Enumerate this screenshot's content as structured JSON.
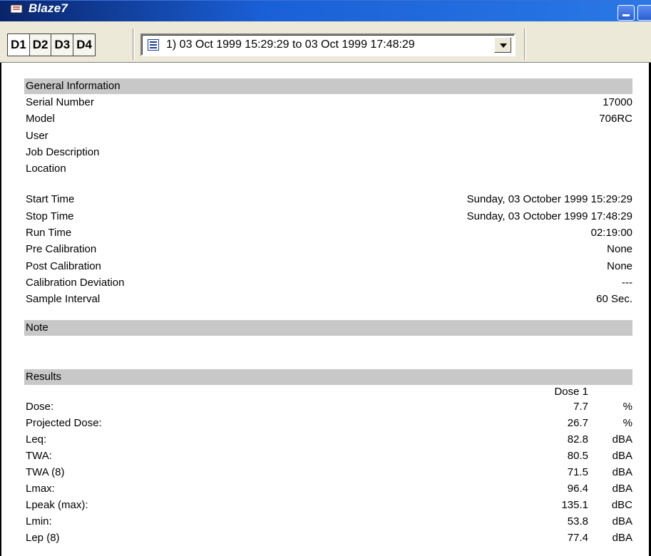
{
  "window": {
    "title": "Blaze7"
  },
  "toolbar": {
    "dataset_buttons": [
      "D1",
      "D2",
      "D3",
      "D4"
    ],
    "session_select": "1) 03 Oct 1999 15:29:29 to 03 Oct 1999 17:48:29"
  },
  "general": {
    "header": "General Information",
    "rows": [
      {
        "label": "Serial Number",
        "value": "17000"
      },
      {
        "label": "Model",
        "value": "706RC"
      },
      {
        "label": "User",
        "value": ""
      },
      {
        "label": "Job Description",
        "value": ""
      },
      {
        "label": "Location",
        "value": ""
      }
    ]
  },
  "timing": {
    "rows": [
      {
        "label": "Start Time",
        "value": "Sunday, 03 October 1999 15:29:29"
      },
      {
        "label": "Stop Time",
        "value": "Sunday, 03 October 1999 17:48:29"
      },
      {
        "label": "Run Time",
        "value": "02:19:00"
      },
      {
        "label": "Pre Calibration",
        "value": "None"
      },
      {
        "label": "Post Calibration",
        "value": "None"
      },
      {
        "label": "Calibration Deviation",
        "value": "---"
      },
      {
        "label": "Sample Interval",
        "value": "60 Sec."
      }
    ]
  },
  "note": {
    "header": "Note"
  },
  "results": {
    "header": "Results",
    "column": "Dose 1",
    "rows": [
      {
        "label": "Dose:",
        "value": "7.7",
        "unit": "%"
      },
      {
        "label": "Projected Dose:",
        "value": "26.7",
        "unit": "%"
      },
      {
        "label": "Leq:",
        "value": "82.8",
        "unit": "dBA"
      },
      {
        "label": "TWA:",
        "value": "80.5",
        "unit": "dBA"
      },
      {
        "label": "TWA (8)",
        "value": "71.5",
        "unit": "dBA"
      },
      {
        "label": "Lmax:",
        "value": "96.4",
        "unit": "dBA"
      },
      {
        "label": "Lpeak (max):",
        "value": "135.1",
        "unit": "dBC"
      },
      {
        "label": "Lmin:",
        "value": "53.8",
        "unit": "dBA"
      },
      {
        "label": "Lep (8)",
        "value": "77.4",
        "unit": "dBA"
      }
    ]
  },
  "colors": {
    "titlebar": "#0a246a",
    "toolbar_bg": "#ece9d8",
    "section_header_bg": "#c8c8c8"
  }
}
